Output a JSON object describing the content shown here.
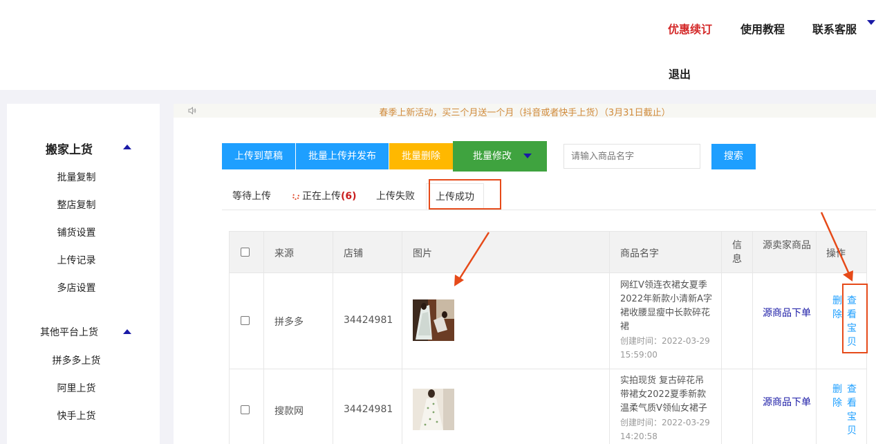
{
  "header": {
    "promo_label": "优惠续订",
    "tutorial_label": "使用教程",
    "service_label": "联系客服",
    "logout_label": "退出"
  },
  "sidebar": {
    "group1": {
      "title": "搬家上货",
      "items": [
        "批量复制",
        "整店复制",
        "铺货设置",
        "上传记录",
        "多店设置"
      ]
    },
    "group2": {
      "title": "其他平台上货",
      "items": [
        "拼多多上货",
        "阿里上货",
        "快手上货"
      ]
    }
  },
  "notice": {
    "text": "春季上新活动，买三个月送一个月（抖音或者快手上货）（3月31日截止）"
  },
  "toolbar": {
    "upload_draft": "上传到草稿",
    "batch_publish": "批量上传并发布",
    "batch_delete": "批量删除",
    "batch_edit": "批量修改",
    "search_placeholder": "请输入商品名字",
    "search_button": "搜索"
  },
  "tabs": {
    "waiting": "等待上传",
    "uploading": "正在上传",
    "uploading_count": "(6)",
    "failed": "上传失败",
    "success": "上传成功"
  },
  "table": {
    "headers": {
      "source": "来源",
      "shop": "店铺",
      "image": "图片",
      "name": "商品名字",
      "info": "信息",
      "source_order": "源卖家商品",
      "action": "操作"
    },
    "rows": [
      {
        "source": "拼多多",
        "shop": "34424981",
        "name": "网红V领连衣裙女夏季2022年新款小清新A字裙收腰显瘦中长款碎花裙",
        "created": "创建时间：2022-03-29 15:59:00",
        "source_order": "源商品下单",
        "delete": "删除",
        "view": "查看宝贝"
      },
      {
        "source": "搜款网",
        "shop": "34424981",
        "name": "实拍现货 复古碎花吊带裙女2022夏季新款温柔气质V领仙女裙子",
        "created": "创建时间：2022-03-29 14:20:58",
        "source_order": "源商品下单",
        "delete": "删除",
        "view": "查看宝贝"
      }
    ]
  },
  "colors": {
    "primary_blue": "#1e9fff",
    "warning_yellow": "#ffb800",
    "success_green": "#3fa33f",
    "promo_red": "#d42a2a",
    "annotation_orange": "#e64a19",
    "notice_text": "#d08a3a"
  }
}
